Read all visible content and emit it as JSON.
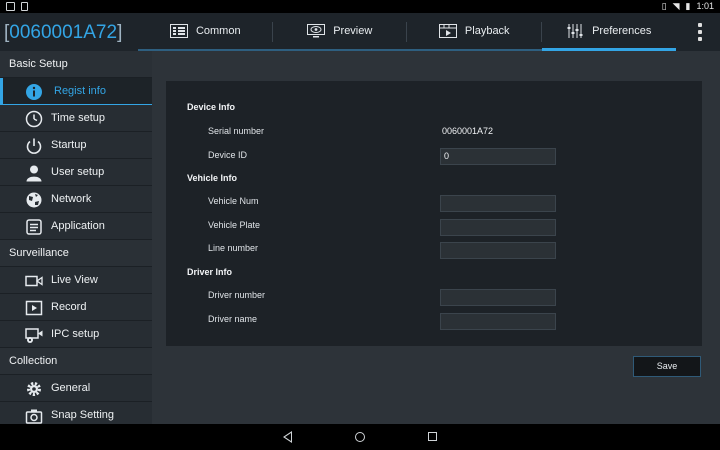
{
  "statusbar": {
    "time": "1:01"
  },
  "header": {
    "device_id": "0060001A72",
    "tabs": [
      {
        "label": "Common",
        "icon": "grid-icon",
        "active": false
      },
      {
        "label": "Preview",
        "icon": "monitor-eye-icon",
        "active": false
      },
      {
        "label": "Playback",
        "icon": "film-icon",
        "active": false
      },
      {
        "label": "Preferences",
        "icon": "sliders-icon",
        "active": true
      }
    ]
  },
  "sidebar": {
    "sections": [
      {
        "title": "Basic Setup",
        "items": [
          {
            "label": "Regist info",
            "icon": "info-icon",
            "active": true
          },
          {
            "label": "Time setup",
            "icon": "clock-icon"
          },
          {
            "label": "Startup",
            "icon": "power-icon"
          },
          {
            "label": "User setup",
            "icon": "user-icon"
          },
          {
            "label": "Network",
            "icon": "globe-icon"
          },
          {
            "label": "Application",
            "icon": "application-icon"
          }
        ]
      },
      {
        "title": "Surveillance",
        "items": [
          {
            "label": "Live View",
            "icon": "video-camera-icon"
          },
          {
            "label": "Record",
            "icon": "record-icon"
          },
          {
            "label": "IPC setup",
            "icon": "ipc-camera-icon"
          }
        ]
      },
      {
        "title": "Collection",
        "items": [
          {
            "label": "General",
            "icon": "gear-icon"
          },
          {
            "label": "Snap Setting",
            "icon": "camera-icon"
          }
        ]
      }
    ]
  },
  "form": {
    "device_info_title": "Device Info",
    "serial_number_label": "Serial number",
    "serial_number_value": "0060001A72",
    "device_id_label": "Device ID",
    "device_id_value": "0",
    "vehicle_info_title": "Vehicle Info",
    "vehicle_num_label": "Vehicle Num",
    "vehicle_num_value": "",
    "vehicle_plate_label": "Vehicle Plate",
    "vehicle_plate_value": "",
    "line_number_label": "Line number",
    "line_number_value": "",
    "driver_info_title": "Driver Info",
    "driver_number_label": "Driver number",
    "driver_number_value": "",
    "driver_name_label": "Driver name",
    "driver_name_value": "",
    "save_label": "Save"
  },
  "colors": {
    "accent": "#33a5e5",
    "panel": "#1d2227",
    "sidebar": "#272d33",
    "header": "#1e242a"
  }
}
